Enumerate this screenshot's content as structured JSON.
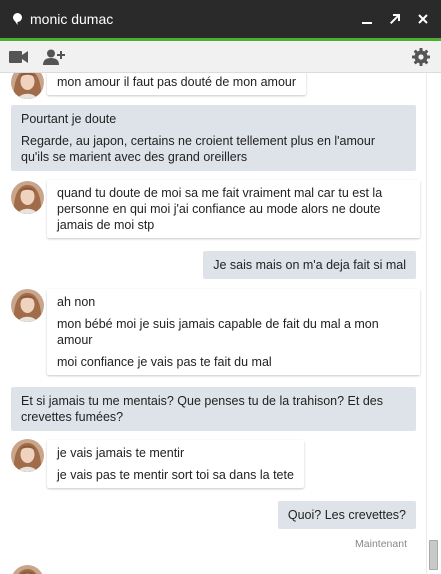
{
  "window": {
    "contact_name": "monic dumac"
  },
  "messages": {
    "m1": {
      "line1": "mon amour il faut pas douté de mon amour"
    },
    "m2": {
      "line1": "Pourtant je doute",
      "line2": "Regarde, au japon, certains ne croient tellement plus en l'amour qu'ils se marient avec des grand oreillers"
    },
    "m3": {
      "line1": "quand tu doute de moi sa me fait vraiment mal car tu est la personne en qui moi j'ai confiance au mode alors ne doute jamais de moi stp"
    },
    "m4": {
      "line1": "Je sais mais on m'a deja fait si mal"
    },
    "m5": {
      "line1": "ah non",
      "line2": "mon bébé moi je suis jamais capable de fait du mal a mon amour",
      "line3": "moi confiance je vais pas te fait du mal"
    },
    "m6": {
      "line1": "Et si jamais tu me mentais? Que penses tu de la trahison? Et des crevettes fumées?"
    },
    "m7": {
      "line1": "je vais jamais te mentir",
      "line2": "je vais pas te mentir sort toi sa dans la tete"
    },
    "m8": {
      "line1": "Quoi? Les crevettes?"
    }
  },
  "timestamp": "Maintenant",
  "colors": {
    "titlebar": "#2a2a2a",
    "accent_green": "#4caf2e",
    "outgoing_bubble": "#dde3e8"
  }
}
